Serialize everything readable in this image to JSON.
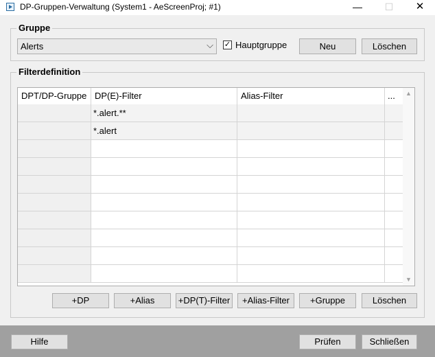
{
  "window": {
    "title": "DP-Gruppen-Verwaltung (System1 - AeScreenProj; #1)",
    "minimize_glyph": "—",
    "maximize_glyph": "☐",
    "close_glyph": "✕"
  },
  "gruppe": {
    "legend": "Gruppe",
    "selected": "Alerts",
    "dropdown_glyph": "⌵",
    "hauptgruppe_label": "Hauptgruppe",
    "hauptgruppe_checked": true,
    "check_glyph": "✓",
    "neu_label": "Neu",
    "loeschen_label": "Löschen"
  },
  "filter": {
    "legend": "Filterdefinition",
    "columns": [
      "DPT/DP-Gruppe",
      "DP(E)-Filter",
      "Alias-Filter",
      "..."
    ],
    "rows": [
      [
        "",
        "*.alert.**",
        "",
        ""
      ],
      [
        "",
        "*.alert",
        "",
        ""
      ],
      [
        "",
        "",
        "",
        ""
      ],
      [
        "",
        "",
        "",
        ""
      ],
      [
        "",
        "",
        "",
        ""
      ],
      [
        "",
        "",
        "",
        ""
      ],
      [
        "",
        "",
        "",
        ""
      ],
      [
        "",
        "",
        "",
        ""
      ],
      [
        "",
        "",
        "",
        ""
      ],
      [
        "",
        "",
        "",
        ""
      ]
    ],
    "scroll_up_glyph": "▲",
    "scroll_down_glyph": "▼",
    "buttons": {
      "add_dp": "+DP",
      "add_alias": "+Alias",
      "add_dpt_filter": "+DP(T)-Filter",
      "add_alias_filter": "+Alias-Filter",
      "add_gruppe": "+Gruppe",
      "loeschen": "Löschen"
    }
  },
  "footer": {
    "hilfe": "Hilfe",
    "pruefen": "Prüfen",
    "schliessen": "Schließen"
  }
}
